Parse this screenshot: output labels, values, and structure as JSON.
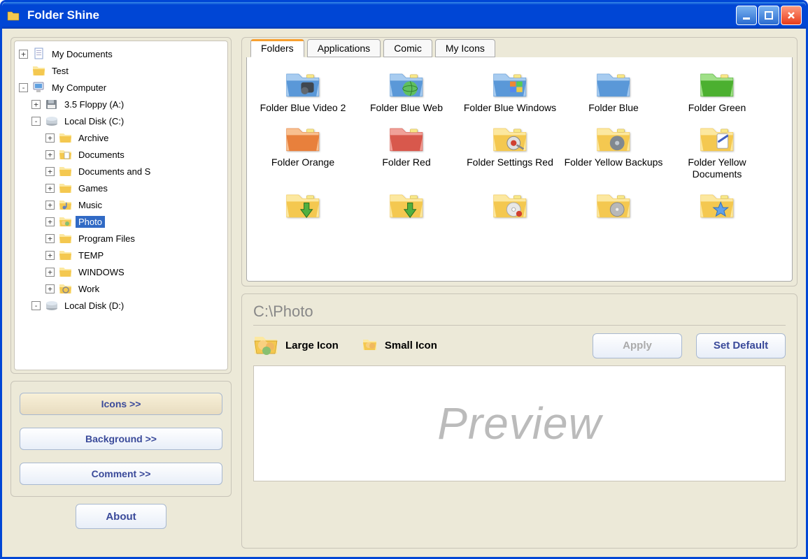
{
  "titlebar": {
    "title": "Folder Shine"
  },
  "tree": [
    {
      "level": 0,
      "exp": "+",
      "icon": "doc",
      "label": "My Documents"
    },
    {
      "level": 0,
      "exp": "",
      "icon": "folder",
      "label": "Test"
    },
    {
      "level": 0,
      "exp": "-",
      "icon": "computer",
      "label": "My Computer"
    },
    {
      "level": 1,
      "exp": "+",
      "icon": "floppy",
      "label": "3.5 Floppy (A:)"
    },
    {
      "level": 1,
      "exp": "-",
      "icon": "disk",
      "label": "Local Disk (C:)"
    },
    {
      "level": 2,
      "exp": "+",
      "icon": "folder",
      "label": "Archive"
    },
    {
      "level": 2,
      "exp": "+",
      "icon": "docfolder",
      "label": "Documents"
    },
    {
      "level": 2,
      "exp": "+",
      "icon": "folder",
      "label": "Documents and S"
    },
    {
      "level": 2,
      "exp": "+",
      "icon": "folder",
      "label": "Games"
    },
    {
      "level": 2,
      "exp": "+",
      "icon": "music",
      "label": "Music"
    },
    {
      "level": 2,
      "exp": "+",
      "icon": "photo",
      "label": "Photo",
      "selected": true
    },
    {
      "level": 2,
      "exp": "+",
      "icon": "folder",
      "label": "Program Files"
    },
    {
      "level": 2,
      "exp": "+",
      "icon": "folder",
      "label": "TEMP"
    },
    {
      "level": 2,
      "exp": "+",
      "icon": "folder",
      "label": "WINDOWS"
    },
    {
      "level": 2,
      "exp": "+",
      "icon": "work",
      "label": "Work"
    },
    {
      "level": 1,
      "exp": "-",
      "icon": "disk",
      "label": "Local Disk (D:)"
    }
  ],
  "actions": {
    "icons": "Icons >>",
    "background": "Background >>",
    "comment": "Comment >>",
    "about": "About"
  },
  "tabs": [
    "Folders",
    "Applications",
    "Comic",
    "My Icons"
  ],
  "selected_tab": 0,
  "icon_gallery": [
    {
      "label": "Folder Blue Video 2",
      "base": "blue",
      "overlay": "video"
    },
    {
      "label": "Folder Blue Web",
      "base": "blue",
      "overlay": "web"
    },
    {
      "label": "Folder Blue Windows",
      "base": "blue",
      "overlay": "windows"
    },
    {
      "label": "Folder Blue",
      "base": "blue",
      "overlay": ""
    },
    {
      "label": "Folder Green",
      "base": "green",
      "overlay": ""
    },
    {
      "label": "Folder Orange",
      "base": "orange",
      "overlay": ""
    },
    {
      "label": "Folder Red",
      "base": "red",
      "overlay": ""
    },
    {
      "label": "Folder Settings Red",
      "base": "yellow",
      "overlay": "settings"
    },
    {
      "label": "Folder Yellow Backups",
      "base": "yellow",
      "overlay": "backup"
    },
    {
      "label": "Folder Yellow Documents",
      "base": "yellow",
      "overlay": "docs"
    },
    {
      "label": "",
      "base": "yellow",
      "overlay": "down"
    },
    {
      "label": "",
      "base": "yellow",
      "overlay": "down2"
    },
    {
      "label": "",
      "base": "yellow",
      "overlay": "cd"
    },
    {
      "label": "",
      "base": "yellow",
      "overlay": "disk"
    },
    {
      "label": "",
      "base": "yellow",
      "overlay": "star"
    }
  ],
  "preview": {
    "path": "C:\\Photo",
    "large_label": "Large Icon",
    "small_label": "Small Icon",
    "apply": "Apply",
    "set_default": "Set Default",
    "placeholder": "Preview"
  },
  "colors": {
    "blue": {
      "light": "#a8ccf0",
      "dark": "#5a98d8"
    },
    "green": {
      "light": "#a0e088",
      "dark": "#4cb030"
    },
    "orange": {
      "light": "#f8c090",
      "dark": "#e8803c"
    },
    "red": {
      "light": "#f0a098",
      "dark": "#d8584c"
    },
    "yellow": {
      "light": "#fce8a0",
      "dark": "#f4c850"
    }
  }
}
